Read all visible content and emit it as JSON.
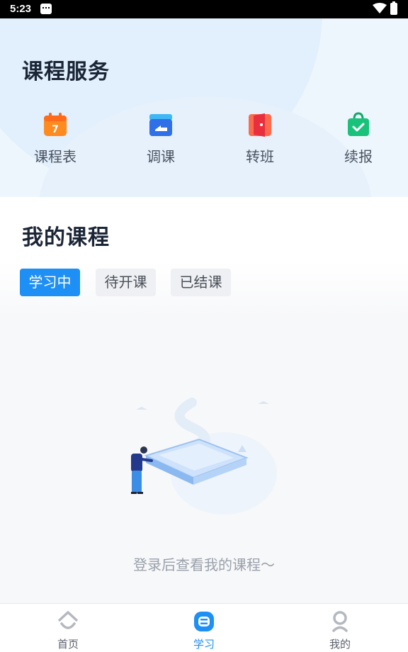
{
  "status_bar": {
    "time": "5:23"
  },
  "services": {
    "title": "课程服务",
    "items": [
      {
        "label": "课程表",
        "icon": "calendar-icon",
        "badge": "7",
        "color": "#ff8a1f"
      },
      {
        "label": "调课",
        "icon": "swap-class-icon",
        "color": "#2f8cf0"
      },
      {
        "label": "转班",
        "icon": "door-icon",
        "color": "#f23c3c"
      },
      {
        "label": "续报",
        "icon": "shopping-bag-icon",
        "color": "#19c27a"
      }
    ]
  },
  "my_courses": {
    "title": "我的课程",
    "tabs": [
      {
        "label": "学习中",
        "active": true
      },
      {
        "label": "待开课",
        "active": false
      },
      {
        "label": "已结课",
        "active": false
      }
    ],
    "empty_message": "登录后查看我的课程～"
  },
  "tab_bar": {
    "items": [
      {
        "label": "首页",
        "icon": "home-icon",
        "active": false
      },
      {
        "label": "学习",
        "icon": "study-icon",
        "active": true
      },
      {
        "label": "我的",
        "icon": "profile-icon",
        "active": false
      }
    ]
  },
  "colors": {
    "accent": "#1e8ff5",
    "title": "#1b2536",
    "muted": "#9aa0aa"
  }
}
